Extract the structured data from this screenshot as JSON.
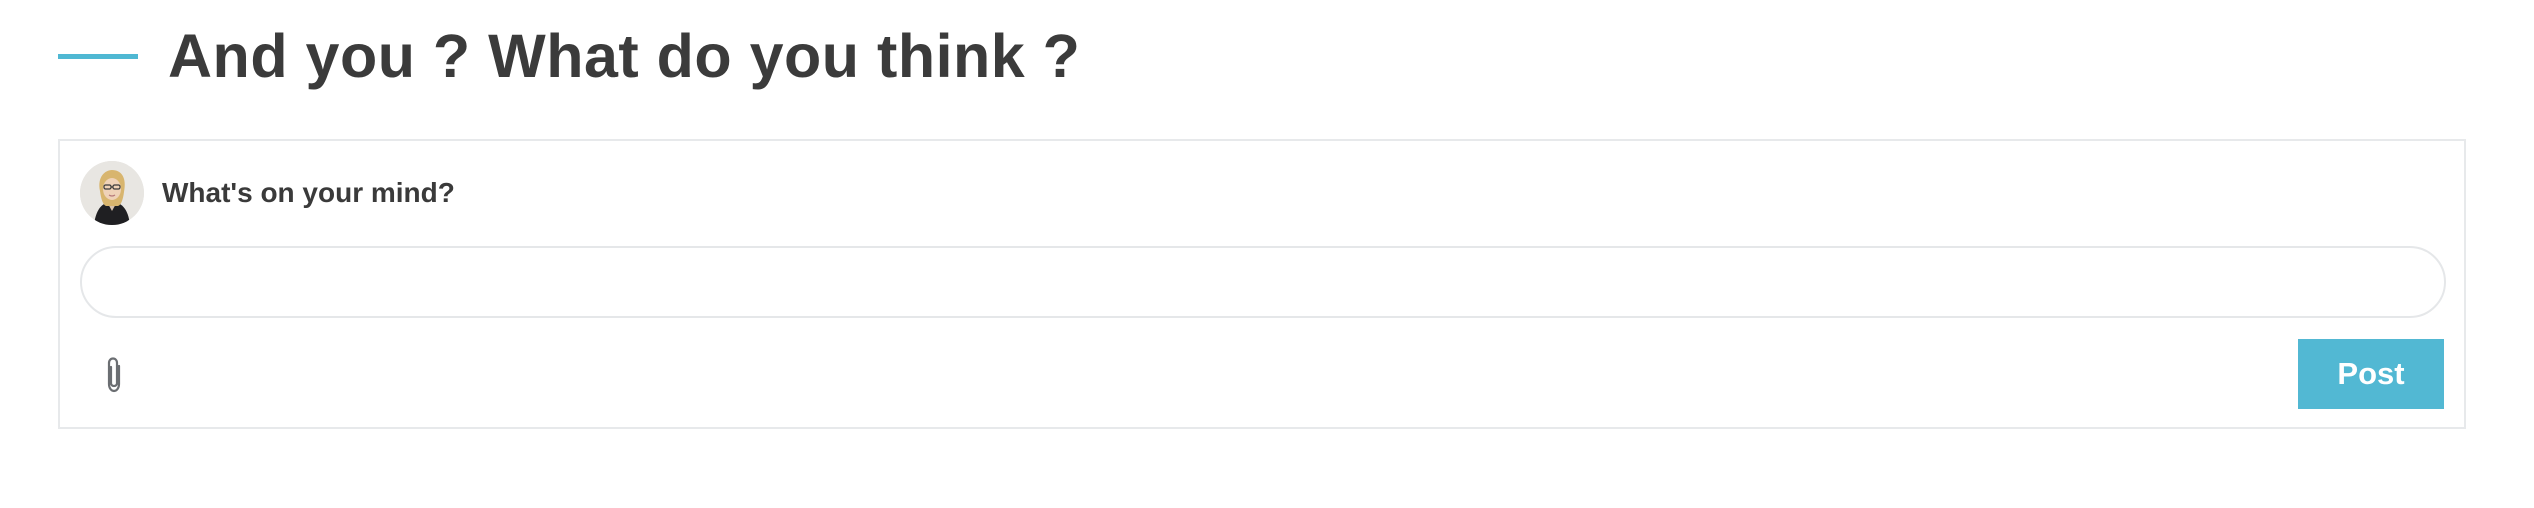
{
  "section": {
    "title": "And you ? What do you think ?"
  },
  "composer": {
    "prompt": "What's on your mind?",
    "input_value": "",
    "input_placeholder": "",
    "post_label": "Post",
    "attach_icon": "paperclip-icon",
    "avatar": "user-avatar"
  },
  "colors": {
    "accent": "#4fb8d3",
    "post_button": "#52b8d3",
    "text": "#3a3a3a",
    "border": "#e7e9eb"
  }
}
